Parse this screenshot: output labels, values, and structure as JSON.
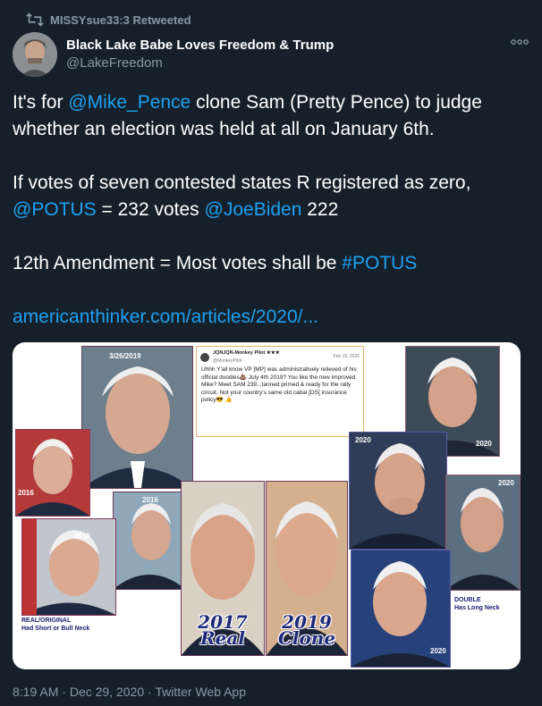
{
  "retweet": {
    "icon": "retweet-icon",
    "text": "MISSYsue33:3 Retweeted"
  },
  "author": {
    "display_name": "Black Lake Babe Loves Freedom & Trump",
    "handle": "@LakeFreedom",
    "avatar_icon": "avatar"
  },
  "more_icon": "more-options-icon",
  "tweet": {
    "p1": {
      "pre": "It's for ",
      "mention": "@Mike_Pence",
      "post": " clone Sam (Pretty Pence) to judge whether an election was held at all on January 6th."
    },
    "p2": {
      "pre": "If votes of seven contested states R registered as zero, ",
      "mention1": "@POTUS",
      "mid": " = 232 votes ",
      "mention2": "@JoeBiden",
      "post": "  222"
    },
    "p3": {
      "pre": "12th Amendment =  Most votes shall be ",
      "hashtag": "#POTUS"
    },
    "link": "americanthinker.com/articles/2020/..."
  },
  "media": {
    "labels": {
      "date_top": "3/26/2019",
      "y2016a": "2016",
      "y2016b": "2016",
      "y2016c": "2016",
      "y2020a": "2020",
      "y2020b": "2020",
      "y2020c": "2020",
      "y2020d": "2020",
      "real_caption1": "REAL/ORIGINAL",
      "real_caption2": "Had Short or Bull Neck",
      "double_caption1": "DOUBLE",
      "double_caption2": "Has Long Neck",
      "big2017a": "2017",
      "big2017b": "Real",
      "big2019a": "2019",
      "big2019b": "Clone"
    },
    "mini_tweet": {
      "name": "JQNJQN-Monkey Pilot ★★★",
      "sub": "@MonkeyPilot",
      "date": "Feb 15, 2020",
      "body": "Uhhh Y'all know VP [MP] was administratively relieved of his official doodies💩 July 4th 2019? You like the new improved Mike? Meet SAM 239...tanned primed & ready for the rally circuit. Not your country's same old cabal [DS] insurance policy😎 👍"
    }
  },
  "footer": {
    "time": "8:19 AM",
    "sep1": " · ",
    "date": "Dec 29, 2020",
    "sep2": " · ",
    "source": "Twitter Web App"
  }
}
